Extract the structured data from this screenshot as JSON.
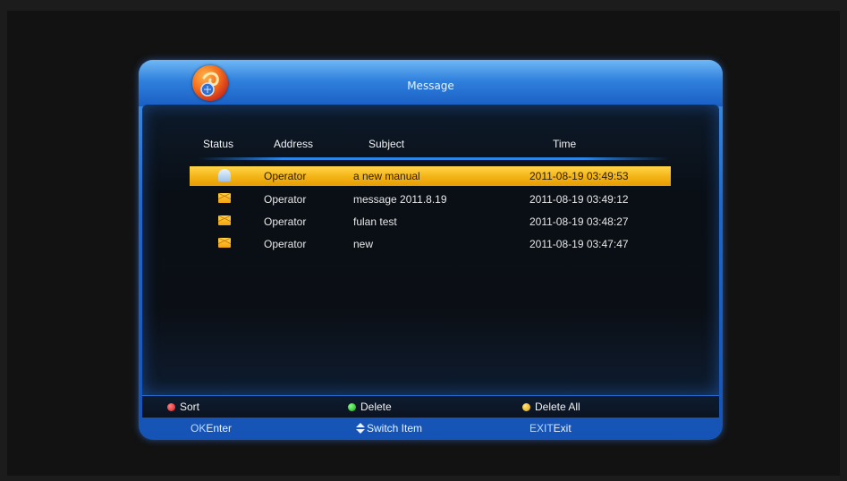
{
  "window": {
    "title": "Message"
  },
  "columns": {
    "status": "Status",
    "address": "Address",
    "subject": "Subject",
    "time": "Time"
  },
  "messages": [
    {
      "status": "read",
      "address": "Operator",
      "subject": "a new manual",
      "time": "2011-08-19 03:49:53",
      "selected": true
    },
    {
      "status": "unread",
      "address": "Operator",
      "subject": "message 2011.8.19",
      "time": "2011-08-19 03:49:12",
      "selected": false
    },
    {
      "status": "unread",
      "address": "Operator",
      "subject": "fulan test",
      "time": "2011-08-19 03:48:27",
      "selected": false
    },
    {
      "status": "unread",
      "address": "Operator",
      "subject": "new",
      "time": "2011-08-19 03:47:47",
      "selected": false
    }
  ],
  "color_keys": [
    {
      "color": "#e02020",
      "label": "Sort"
    },
    {
      "color": "#20b020",
      "label": "Delete"
    },
    {
      "color": "#f0b000",
      "label": "Delete All"
    }
  ],
  "footer": {
    "ok_key": "OK",
    "ok_label": "Enter",
    "switch_label": "Switch Item",
    "exit_key": "EXIT",
    "exit_label": "Exit"
  },
  "colors": {
    "highlight": "#f4b315",
    "frame": "#1f67c9"
  }
}
